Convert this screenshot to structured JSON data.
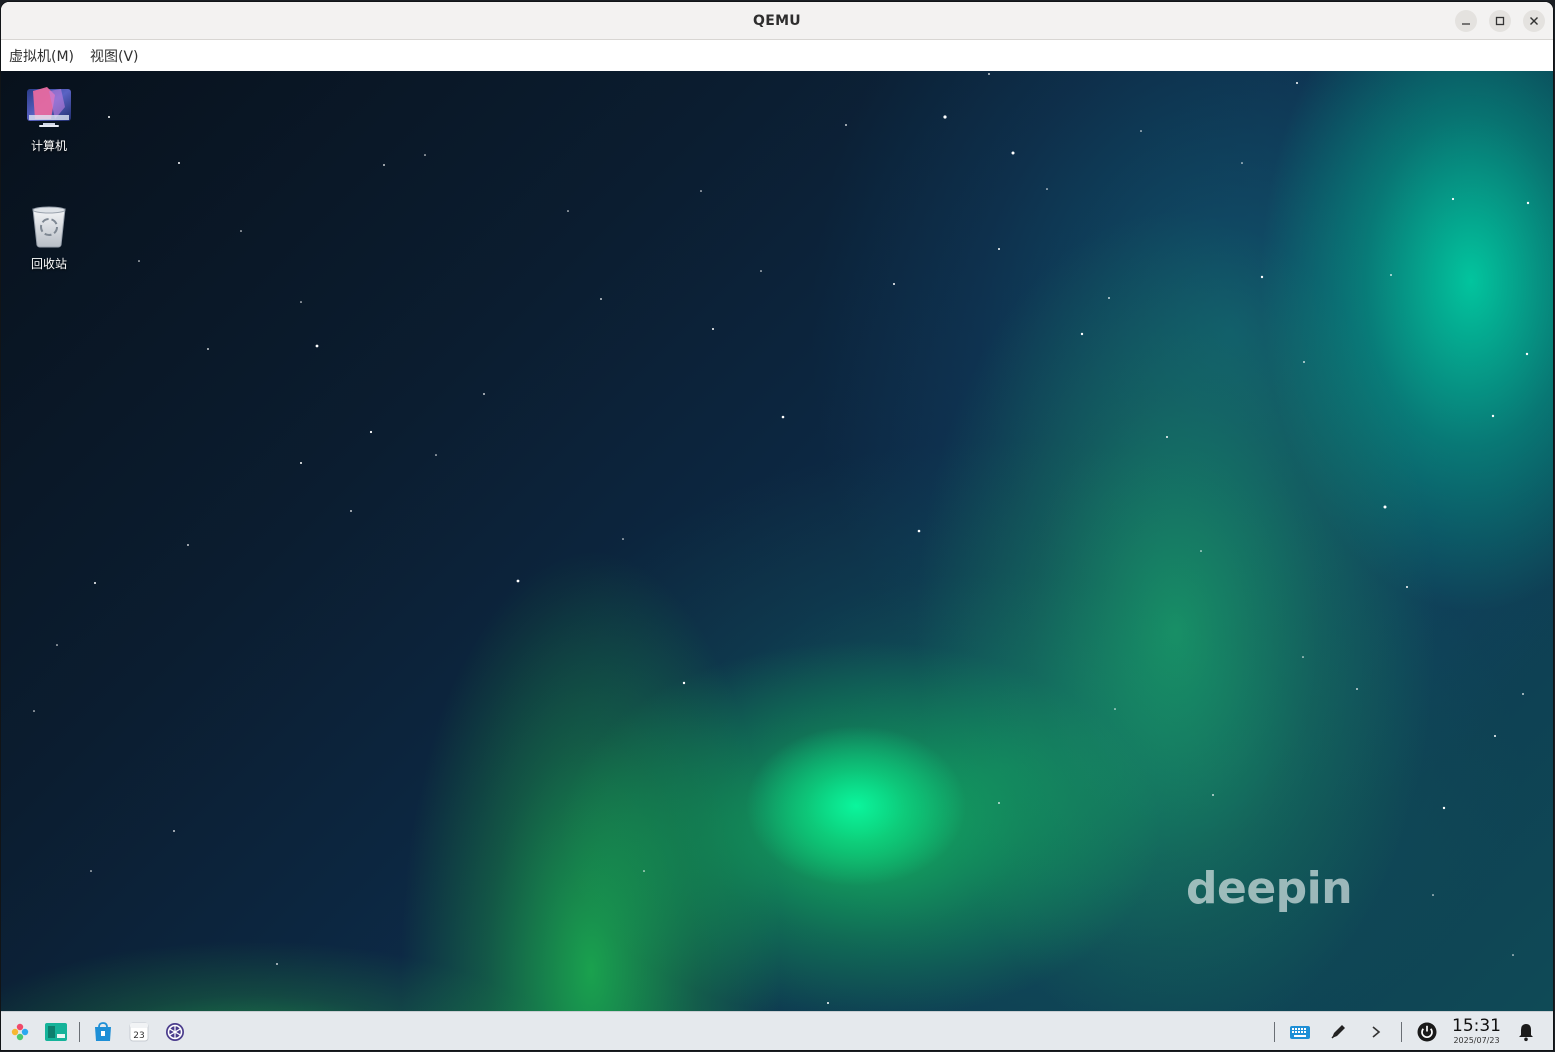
{
  "window": {
    "title": "QEMU",
    "controls": [
      "minimize-icon",
      "maximize-icon",
      "close-icon"
    ]
  },
  "menubar": {
    "items": [
      {
        "label": "虚拟机(M)"
      },
      {
        "label": "视图(V)"
      }
    ]
  },
  "desktop": {
    "icons": [
      {
        "label": "计算机",
        "icon": "computer-icon"
      },
      {
        "label": "回收站",
        "icon": "trash-icon"
      }
    ],
    "watermark": "deepin"
  },
  "dock": {
    "left_items": [
      "launcher-icon",
      "multitask-view-icon",
      "app-store-icon",
      "calendar-icon",
      "settings-icon"
    ],
    "calendar_day": "23",
    "tray_items": [
      "keyboard-icon",
      "pen-icon",
      "expand-tray-icon",
      "power-icon",
      "notification-bell-icon"
    ],
    "clock": {
      "time": "15:31",
      "date": "2025/07/23"
    }
  },
  "colors": {
    "titlebar": "#f3f2f1",
    "menubar": "#ffffff",
    "dock": "#e4e8ec",
    "accent": "#1e8fd6"
  }
}
